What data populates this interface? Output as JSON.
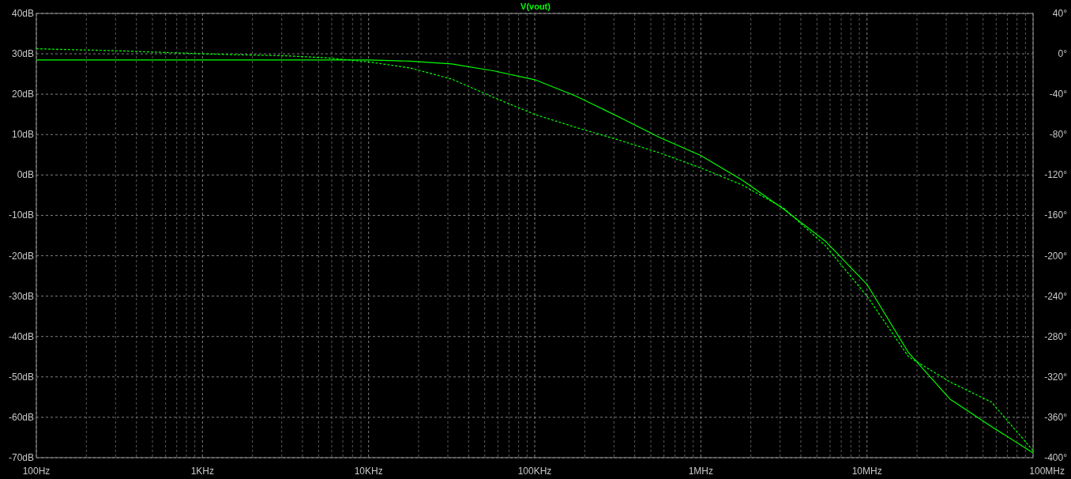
{
  "chart_data": {
    "type": "line",
    "categories": [
      "100Hz",
      null,
      null,
      null,
      "1KHz",
      null,
      null,
      null,
      "10KHz",
      null,
      null,
      null,
      "100KHz",
      null,
      null,
      null,
      "1MHz",
      null,
      null,
      null,
      "10MHz",
      null,
      null,
      null,
      "100MHz"
    ],
    "grid": true,
    "ylim": [
      -70,
      40
    ],
    "y2lim": [
      -400,
      40
    ],
    "yticks": [
      {
        "value": 40,
        "label": "40dB"
      },
      {
        "value": 30,
        "label": "30dB"
      },
      {
        "value": 20,
        "label": "20dB"
      },
      {
        "value": 10,
        "label": "10dB"
      },
      {
        "value": 0,
        "label": "0dB"
      },
      {
        "value": -10,
        "label": "-10dB"
      },
      {
        "value": -20,
        "label": "-20dB"
      },
      {
        "value": -30,
        "label": "-30dB"
      },
      {
        "value": -40,
        "label": "-40dB"
      },
      {
        "value": -50,
        "label": "-50dB"
      },
      {
        "value": -60,
        "label": "-60dB"
      },
      {
        "value": -70,
        "label": "-70dB"
      }
    ],
    "y2ticks": [
      {
        "value": 40,
        "label": "40°"
      },
      {
        "value": 0,
        "label": "0°"
      },
      {
        "value": -40,
        "label": "-40°"
      },
      {
        "value": -80,
        "label": "-80°"
      },
      {
        "value": -120,
        "label": "-120°"
      },
      {
        "value": -160,
        "label": "-160°"
      },
      {
        "value": -200,
        "label": "-200°"
      },
      {
        "value": -240,
        "label": "-240°"
      },
      {
        "value": -280,
        "label": "-280°"
      },
      {
        "value": -320,
        "label": "-320°"
      },
      {
        "value": -360,
        "label": "-360°"
      },
      {
        "value": -400,
        "label": "-400°"
      }
    ],
    "series": [
      {
        "name": "V(vout)",
        "color": "#00ff00",
        "values": [
          28.5,
          28.5,
          28.5,
          28.5,
          28.5,
          28.5,
          28.5,
          28.5,
          28.5,
          28.2,
          27.5,
          25.8,
          23.6,
          19.5,
          14.5,
          9.3,
          4.8,
          -1.3,
          -8.5,
          -16.4,
          -27.1,
          -44,
          -55.5,
          -62.3,
          -68.8
        ]
      },
      {
        "color": "#00ff00",
        "axis": "y2",
        "line_style": "dashed",
        "values": [
          5,
          4,
          3,
          1.5,
          0,
          -1,
          -2,
          -4,
          -8,
          -14,
          -25,
          -43,
          -60,
          -73,
          -85,
          -98,
          -113,
          -130,
          -153,
          -190,
          -240,
          -300,
          -325,
          -345,
          -393
        ]
      }
    ]
  }
}
